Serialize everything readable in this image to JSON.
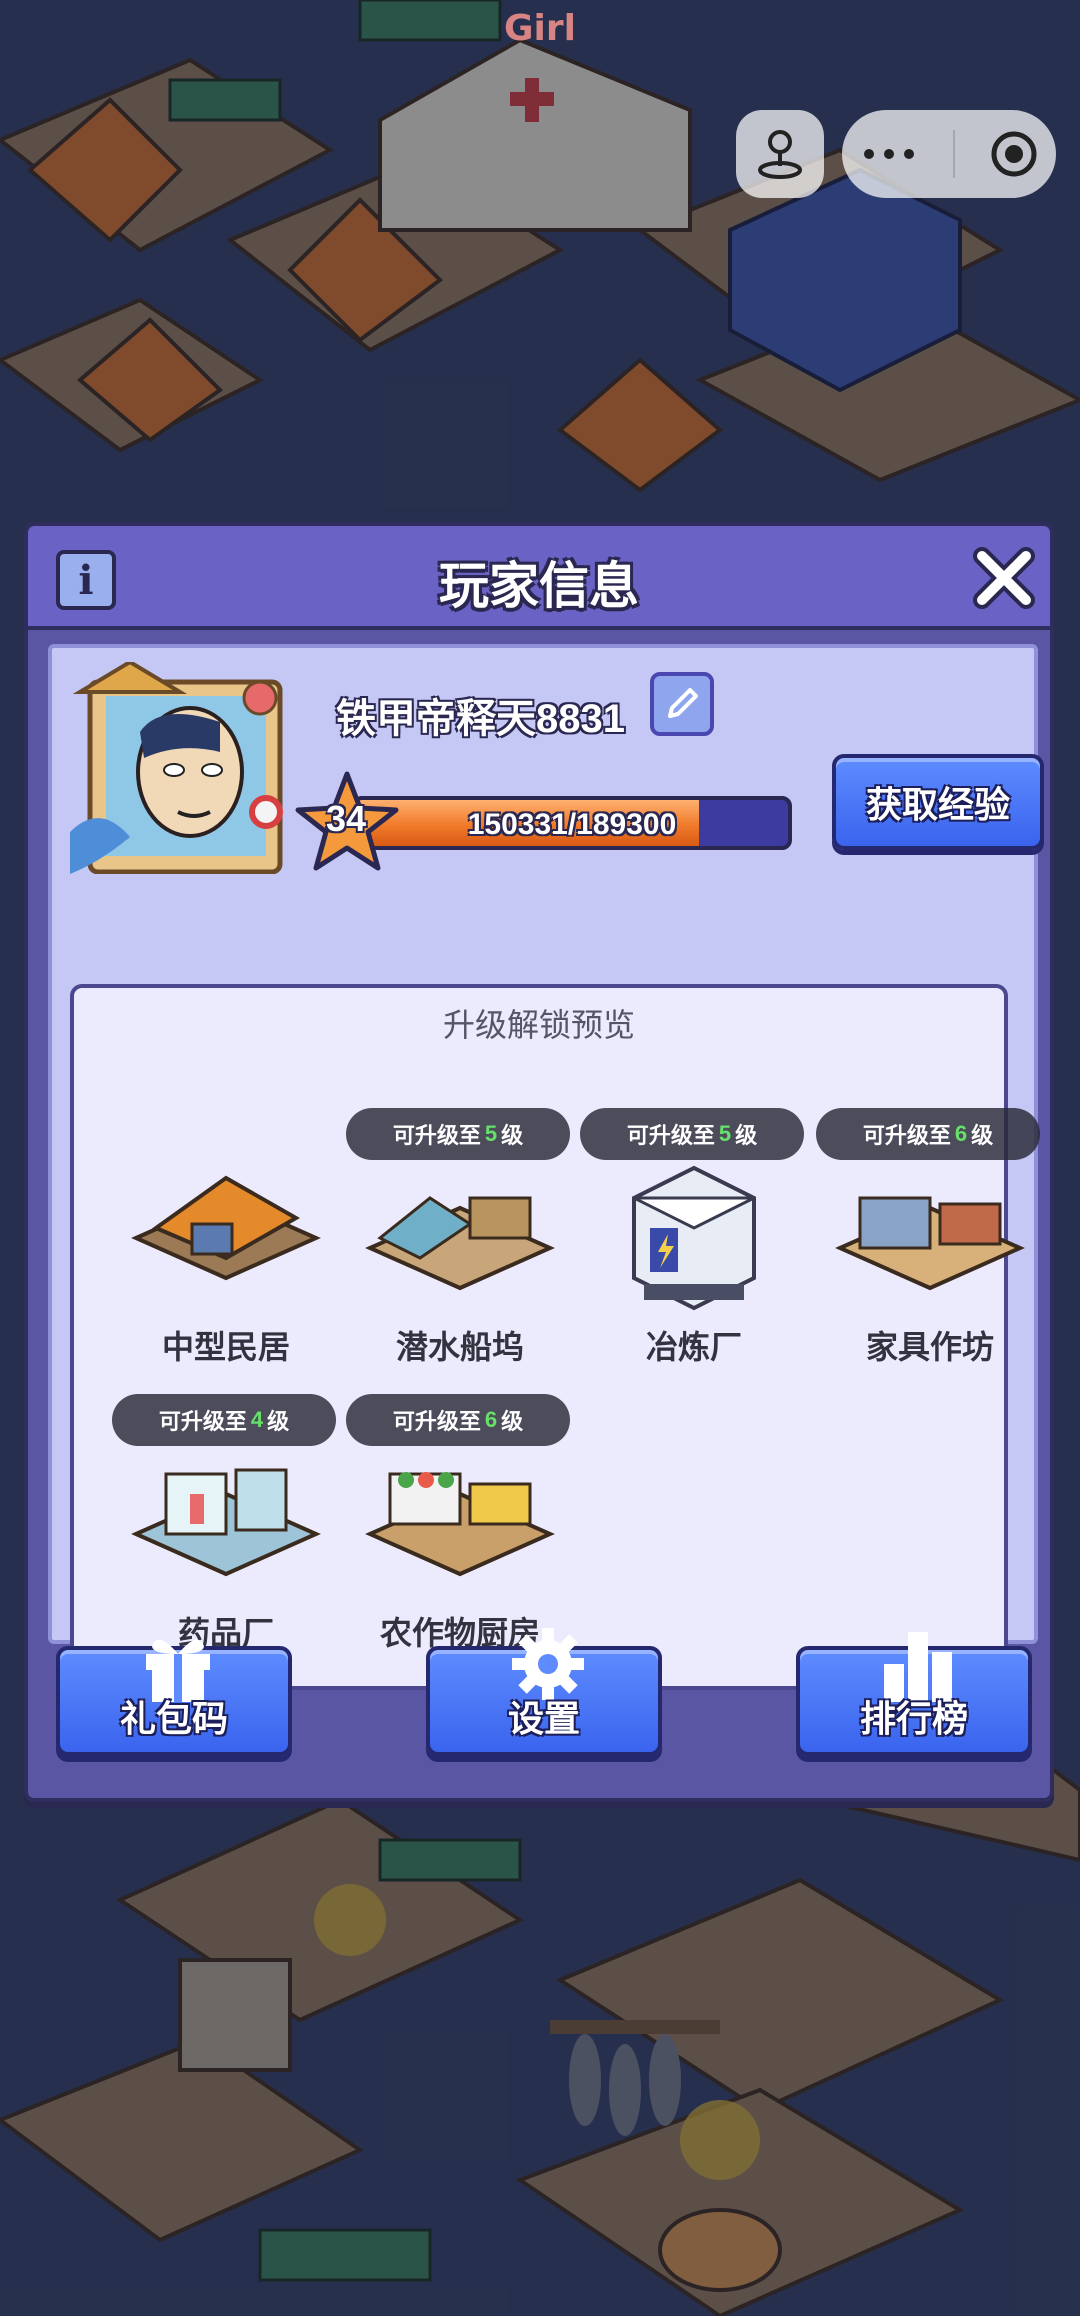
{
  "top_label": "Girl",
  "dialog": {
    "title": "玩家信息",
    "info_icon": "i"
  },
  "player": {
    "name": "铁甲帝释天8831",
    "level": "34",
    "xp_text": "150331/189300",
    "xp_current": 150331,
    "xp_max": 189300,
    "get_exp_label": "获取经验"
  },
  "preview": {
    "title": "升级解锁预览",
    "buildings": [
      {
        "name": "中型民居",
        "badge": null
      },
      {
        "name": "潜水船坞",
        "badge": {
          "prefix": "可升级至",
          "level": "5",
          "suffix": "级"
        }
      },
      {
        "name": "冶炼厂",
        "badge": {
          "prefix": "可升级至",
          "level": "5",
          "suffix": "级"
        }
      },
      {
        "name": "家具作坊",
        "badge": {
          "prefix": "可升级至",
          "level": "6",
          "suffix": "级"
        }
      },
      {
        "name": "药品厂",
        "badge": {
          "prefix": "可升级至",
          "level": "4",
          "suffix": "级"
        }
      },
      {
        "name": "农作物厨房",
        "badge": {
          "prefix": "可升级至",
          "level": "6",
          "suffix": "级"
        }
      }
    ]
  },
  "bottom_buttons": {
    "gift_code": "礼包码",
    "settings": "设置",
    "ranking": "排行榜"
  },
  "colors": {
    "dialog_bg": "#5b56a3",
    "header_bg": "#6a63c5",
    "button_blue": "#3a64ee",
    "xp_orange": "#f07a2a",
    "level_badge_green": "#66e06a"
  },
  "icons": {
    "capsule_left": "joystick-icon",
    "capsule_menu": "more-icon",
    "capsule_close": "target-icon",
    "edit": "pencil-icon",
    "close": "close-icon",
    "gift": "gift-icon",
    "settings": "gear-icon",
    "ranking": "bar-chart-icon"
  }
}
